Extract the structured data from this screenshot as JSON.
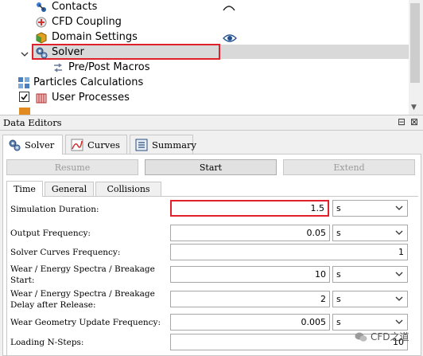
{
  "tree": {
    "items": [
      {
        "label": "Contacts",
        "icon": "contacts-icon",
        "indent": 2
      },
      {
        "label": "CFD Coupling",
        "icon": "cfd-coupling-icon",
        "indent": 2
      },
      {
        "label": "Domain Settings",
        "icon": "domain-settings-icon",
        "indent": 2
      },
      {
        "label": "Solver",
        "icon": "solver-gear-icon",
        "indent": 1,
        "selected": true
      },
      {
        "label": "Pre/Post Macros",
        "icon": "macros-icon",
        "indent": 3
      },
      {
        "label": "Particles Calculations",
        "icon": "particles-icon",
        "indent": 0
      },
      {
        "label": "User Processes",
        "icon": "user-processes-icon",
        "indent": 0,
        "checked": true
      }
    ]
  },
  "data_editors": {
    "title": "Data Editors",
    "window_controls": [
      "⊟",
      "⊠"
    ],
    "tabs": [
      {
        "label": "Solver",
        "icon": "solver-gear-icon",
        "active": true
      },
      {
        "label": "Curves",
        "icon": "curves-chart-icon",
        "active": false
      },
      {
        "label": "Summary",
        "icon": "summary-list-icon",
        "active": false
      }
    ],
    "buttons": {
      "resume": "Resume",
      "start": "Start",
      "extend": "Extend"
    },
    "sub_tabs": [
      {
        "label": "Time",
        "active": true
      },
      {
        "label": "General",
        "active": false
      },
      {
        "label": "Collisions",
        "active": false
      }
    ],
    "fields": [
      {
        "label": "Simulation Duration:",
        "value": "1.5",
        "unit": "s"
      },
      {
        "label": "Output Frequency:",
        "value": "0.05",
        "unit": "s"
      },
      {
        "label": "Solver Curves Frequency:",
        "value": "1",
        "unit": ""
      },
      {
        "label_line1": "Wear / Energy Spectra / Breakage",
        "label_line2": "Start:",
        "value": "10",
        "unit": "s"
      },
      {
        "label_line1": "Wear / Energy Spectra / Breakage",
        "label_line2": "Delay after Release:",
        "value": "2",
        "unit": "s"
      },
      {
        "label": "Wear Geometry Update Frequency:",
        "value": "0.005",
        "unit": "s"
      },
      {
        "label": "Loading N-Steps:",
        "value": "10",
        "unit": ""
      }
    ]
  },
  "watermark": "CFD之道",
  "colors": {
    "highlight": "#e0212b",
    "selection": "#d9d9d9"
  }
}
